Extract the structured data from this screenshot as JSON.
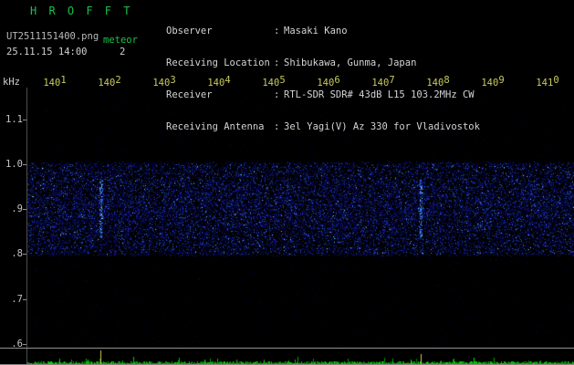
{
  "app": {
    "title": "H R O F F T"
  },
  "header": {
    "filename": "UT2511151400.png",
    "obs_code": "meteor",
    "datetime": "25.11.15 14:00",
    "counter": "2",
    "colon": ":",
    "info": [
      {
        "label": "Observer",
        "value": "Masaki Kano"
      },
      {
        "label": "Receiving Location",
        "value": "Shibukawa, Gunma, Japan"
      },
      {
        "label": "Receiver",
        "value": "RTL-SDR SDR# 43dB L15 103.2MHz CW"
      },
      {
        "label": "Receiving Antenna",
        "value": "3el Yagi(V) Az 330 for Vladivostok"
      }
    ]
  },
  "axes": {
    "y_unit": "kHz"
  },
  "colors": {
    "accent_green": "#18c24a",
    "tick_yellow": "#c9c95e",
    "marker_yellow": "#cdcd55",
    "trace_green": "#00aa00",
    "band_blue": "#1133aa",
    "text": "#c8c8c8"
  },
  "chart_data": {
    "type": "heatmap",
    "title": "HROFFT meteor-echo spectrogram, 10-minute window",
    "x": {
      "labels": [
        "1401",
        "1402",
        "1403",
        "1404",
        "1405",
        "1406",
        "1407",
        "1408",
        "1409",
        "1410"
      ],
      "unit": "UT HHMM",
      "span_min": 10
    },
    "y": {
      "unit": "kHz",
      "tick_labels": [
        "1.1",
        "1.0",
        ".9",
        ".8",
        ".7",
        ".6"
      ],
      "top_khz": 1.17,
      "bottom_khz": 0.59
    },
    "noise_band": {
      "low_khz": 0.8,
      "high_khz": 1.0,
      "center_khz": 0.9
    },
    "event_markers": [
      {
        "t_min": 1.35,
        "height": 15
      },
      {
        "t_min": 7.2,
        "height": 11
      }
    ],
    "level_trace": {
      "color": "#00aa00",
      "position": "bottom strip"
    }
  }
}
